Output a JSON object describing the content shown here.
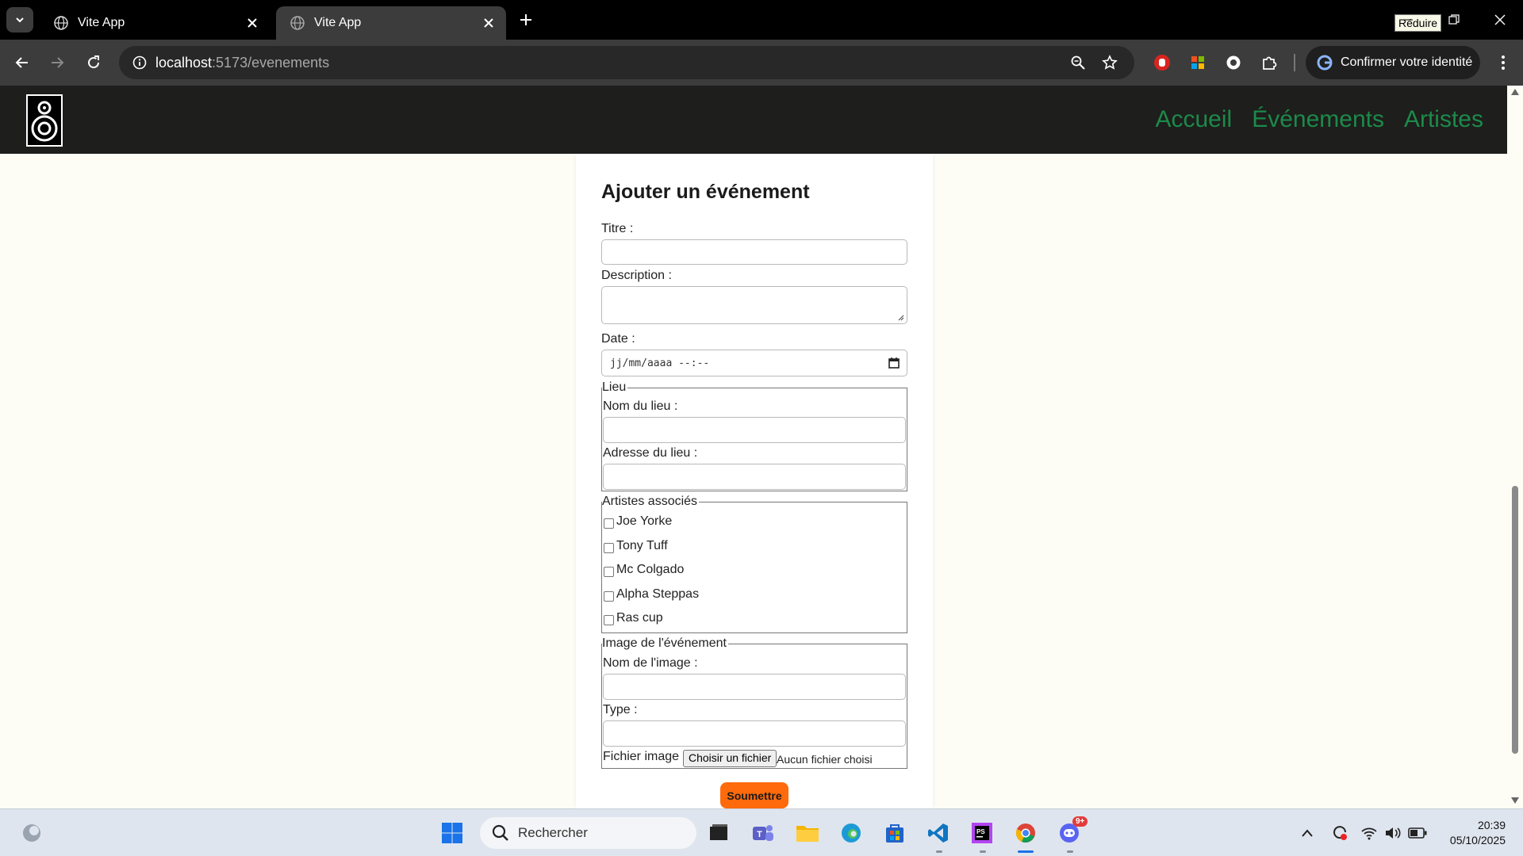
{
  "browser": {
    "tabs": [
      {
        "title": "Vite App",
        "active": false
      },
      {
        "title": "Vite App",
        "active": true
      }
    ],
    "tooltip": "Réduire",
    "url_host": "localhost",
    "url_rest": ":5173/evenements",
    "profile_label": "Confirmer votre identité"
  },
  "site": {
    "nav": [
      "Accueil",
      "Événements",
      "Artistes"
    ],
    "nav_color": "#1c8a4a"
  },
  "form": {
    "title": "Ajouter un événement",
    "titre_label": "Titre :",
    "description_label": "Description :",
    "date_label": "Date :",
    "date_placeholder": "jj/mm/aaaa --:--",
    "lieu": {
      "legend": "Lieu",
      "nom_label": "Nom du lieu :",
      "adresse_label": "Adresse du lieu :"
    },
    "artistes": {
      "legend": "Artistes associés",
      "items": [
        "Joe Yorke",
        "Tony Tuff",
        "Mc Colgado",
        "Alpha Steppas",
        "Ras cup"
      ]
    },
    "image": {
      "legend": "Image de l'événement",
      "nom_label": "Nom de l'image :",
      "type_label": "Type :",
      "fichier_label": "Fichier image :",
      "file_button": "Choisir un fichier",
      "file_status": "Aucun fichier choisi"
    },
    "submit_label": "Soumettre",
    "submit_color": "#ff6a0c"
  },
  "taskbar": {
    "search_placeholder": "Rechercher",
    "time": "20:39",
    "date": "05/10/2025",
    "discord_badge": "9+"
  }
}
